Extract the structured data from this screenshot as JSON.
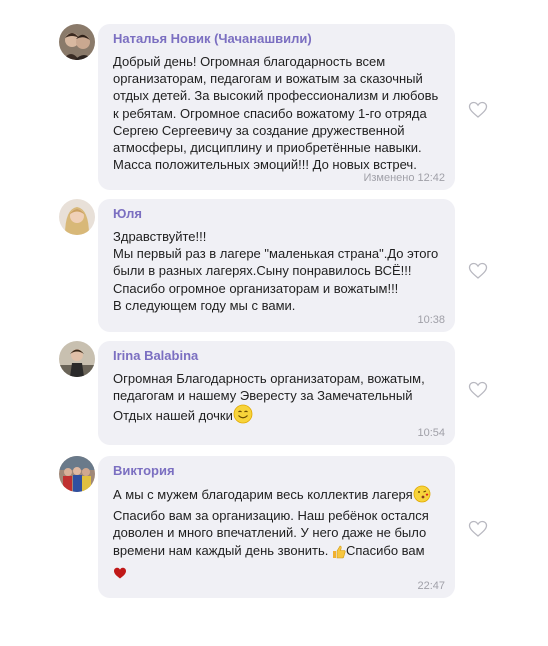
{
  "messages": [
    {
      "author": "Наталья Новик (Чачанашвили)",
      "text": "Добрый день! Огромная благодарность всем\nорганизаторам, педагогам и вожатым за сказочный\nотдых детей. За высокий профессионализм и любовь\nк ребятам. Огромное спасибо вожатому 1-го отряда\nСергею Сергеевичу за создание дружественной\nатмосферы, дисциплину и приобретённые навыки.\nМасса положительных эмоций!!! До новых встреч.",
      "edited_label": "Изменено",
      "time": "12:42"
    },
    {
      "author": "Юля",
      "text": "Здравствуйте!!!\nМы первый раз в лагере \"маленькая страна\".До этого\nбыли в разных лагерях.Сыну понравилось ВСЁ!!!\nСпасибо огромное организаторам и вожатым!!!\nВ следующем году мы с вами.",
      "time": "10:38"
    },
    {
      "author": "Irina Balabina",
      "text": "Огромная Благодарность организаторам, вожатым,\nпедагогам и нашему Эвересту за Замечательный\n",
      "text_tail": "Отдых нашей дочки",
      "time": "10:54"
    },
    {
      "author": "Виктория",
      "line1": "А мы с мужем  благодарим весь коллектив лагеря",
      "line2": "Спасибо вам за организацию. Наш ребёнок остался\nдоволен и много впечатлений. У него даже не было",
      "line3": "времени нам каждый день звонить. ",
      "line3_tail": "Спасибо вам",
      "time": "22:47"
    }
  ],
  "icons": {
    "heart": "heart-outline-icon",
    "smile": "smiling-face-emoji",
    "kiss": "kissing-face-emoji",
    "thumbs": "thumbs-up-emoji",
    "heart_emoji": "heart-emoji"
  },
  "colors": {
    "author": "#7b6fc1",
    "bubble": "#f0f0f5",
    "meta": "#a0a0a8"
  }
}
